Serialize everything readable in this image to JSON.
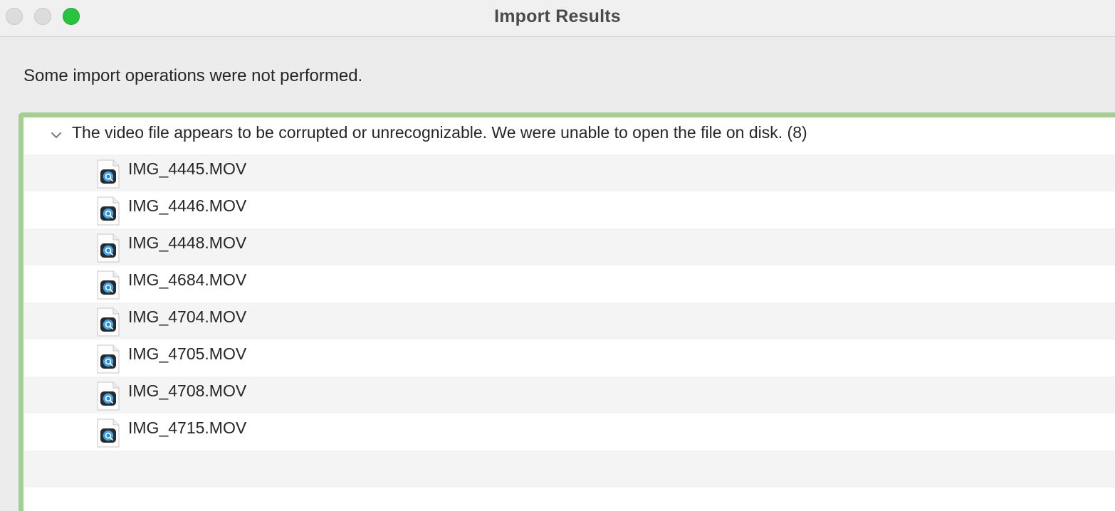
{
  "window": {
    "title": "Import Results"
  },
  "message": "Some import operations were not performed.",
  "group": {
    "label": "The video file appears to be corrupted or unrecognizable. We were unable to open the file on disk. (8)",
    "expanded": true
  },
  "files": [
    {
      "name": "IMG_4445.MOV",
      "icon": "quicktime-file-icon"
    },
    {
      "name": "IMG_4446.MOV",
      "icon": "quicktime-file-icon"
    },
    {
      "name": "IMG_4448.MOV",
      "icon": "quicktime-file-icon"
    },
    {
      "name": "IMG_4684.MOV",
      "icon": "quicktime-file-icon"
    },
    {
      "name": "IMG_4704.MOV",
      "icon": "quicktime-file-icon"
    },
    {
      "name": "IMG_4705.MOV",
      "icon": "quicktime-file-icon"
    },
    {
      "name": "IMG_4708.MOV",
      "icon": "quicktime-file-icon"
    },
    {
      "name": "IMG_4715.MOV",
      "icon": "quicktime-file-icon"
    }
  ],
  "colors": {
    "focus_ring": "#a3cf92",
    "zoom_button": "#2ac33f",
    "row_alt": "#f4f4f4"
  }
}
